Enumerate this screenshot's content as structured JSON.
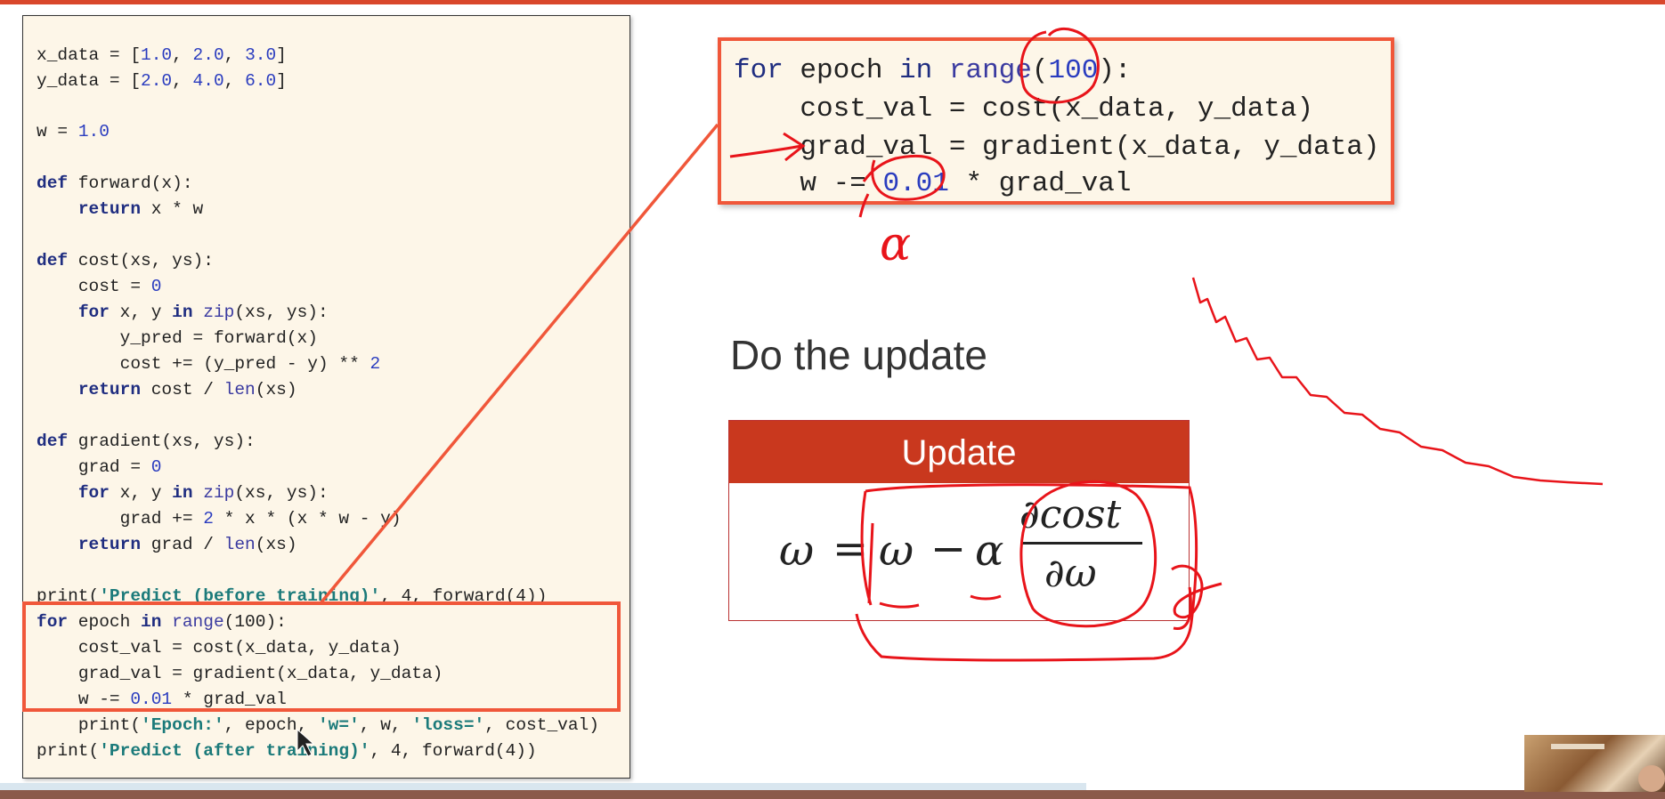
{
  "code_panel": {
    "lines": [
      {
        "pre": "x_data = [",
        "a": "1.0",
        "s1": ", ",
        "b": "2.0",
        "s2": ", ",
        "c": "3.0",
        "post": "]"
      },
      {
        "pre": "y_data = [",
        "a": "2.0",
        "s1": ", ",
        "b": "4.0",
        "s2": ", ",
        "c": "6.0",
        "post": "]"
      },
      {
        "w_init": "w = ",
        "w_val": "1.0"
      },
      {
        "def": "def",
        "sig": " forward(x):"
      },
      {
        "indent": "    ",
        "ret": "return",
        "expr": " x * w"
      },
      {
        "def": "def",
        "sig": " cost(xs, ys):"
      },
      {
        "indent": "    ",
        "expr": "cost = ",
        "num": "0"
      },
      {
        "indent": "    ",
        "for": "for",
        "mid": " x, y ",
        "in": "in",
        "fn": " zip",
        "rest": "(xs, ys):"
      },
      {
        "indent": "        ",
        "expr": "y_pred = forward(x)"
      },
      {
        "indent": "        ",
        "expr": "cost += (y_pred - y) ** ",
        "num": "2"
      },
      {
        "indent": "    ",
        "ret": "return",
        "expr": " cost / ",
        "fn": "len",
        "rest": "(xs)"
      },
      {
        "def": "def",
        "sig": " gradient(xs, ys):"
      },
      {
        "indent": "    ",
        "expr": "grad = ",
        "num": "0"
      },
      {
        "indent": "    ",
        "for": "for",
        "mid": " x, y ",
        "in": "in",
        "fn": " zip",
        "rest": "(xs, ys):"
      },
      {
        "indent": "        ",
        "expr": "grad += ",
        "num": "2",
        "rest": " * x * (x * w - y)"
      },
      {
        "indent": "    ",
        "ret": "return",
        "expr": " grad / ",
        "fn": "len",
        "rest": "(xs)"
      },
      {
        "print": "print(",
        "str": "'Predict (before training)'",
        "rest": ", 4, forward(4))"
      },
      {
        "for": "for",
        "mid": " epoch ",
        "in": "in",
        "fn": " range",
        "rest": "(100):"
      },
      {
        "indent": "    ",
        "expr": "cost_val = cost(x_data, y_data)"
      },
      {
        "indent": "    ",
        "expr": "grad_val = gradient(x_data, y_data)"
      },
      {
        "indent": "    ",
        "expr": "w -= ",
        "num": "0.01",
        "rest": " * grad_val"
      },
      {
        "indent": "    ",
        "print": "print(",
        "str": "'Epoch:'",
        "mid": ", epoch, ",
        "str2": "'w='",
        "mid2": ", w, ",
        "str3": "'loss='",
        "rest": ", cost_val)"
      },
      {
        "print": "print(",
        "str": "'Predict (after training)'",
        "rest": ", 4, forward(4))"
      }
    ]
  },
  "zoom_code": {
    "line1": {
      "for": "for",
      "mid": " epoch ",
      "in": "in",
      "fn": " range",
      "open": "(",
      "num": "100",
      "close": "):"
    },
    "line2": "    cost_val = cost(x_data, y_data)",
    "line3": "    grad_val = gradient(x_data, y_data)",
    "line4": {
      "pre": "    w -= ",
      "num": "0.01",
      "post": " * grad_val"
    }
  },
  "slide": {
    "heading": "Do the update",
    "update_title": "Update",
    "formula": {
      "lhs": "ω",
      "eq": "=",
      "w": "ω",
      "minus": "−",
      "alpha": "α",
      "num": "∂cost",
      "den": "∂ω"
    }
  },
  "annotations": {
    "alpha_note": "α"
  },
  "colors": {
    "accent": "#f0573a",
    "update_header": "#c9381e",
    "ink": "#e8141a",
    "panel_bg": "#fdf6e8"
  }
}
